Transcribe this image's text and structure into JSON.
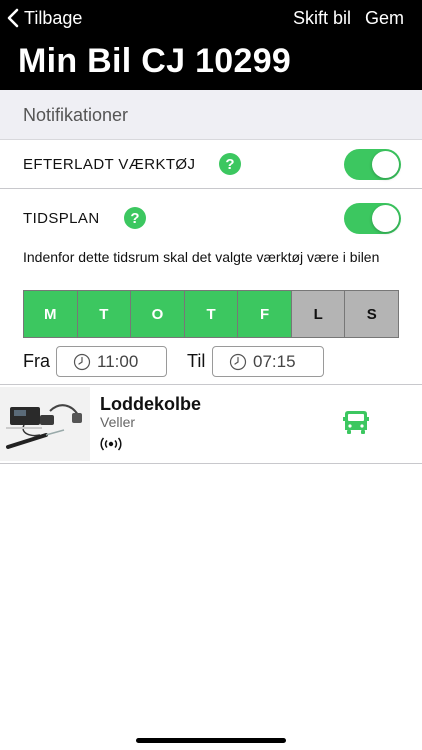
{
  "nav": {
    "back_label": "Tilbage",
    "switch_car_label": "Skift bil",
    "save_label": "Gem"
  },
  "page": {
    "title": "Min Bil CJ 10299"
  },
  "section": {
    "title": "Notifikationer"
  },
  "settings": {
    "left_tool": {
      "label": "EFTERLADT VÆRKTØJ",
      "help": "?",
      "enabled": true
    },
    "schedule": {
      "label": "TIDSPLAN",
      "help": "?",
      "enabled": true
    },
    "description": "Indenfor dette tidsrum skal det valgte værktøj være i bilen"
  },
  "days": [
    {
      "label": "M",
      "active": true
    },
    {
      "label": "T",
      "active": true
    },
    {
      "label": "O",
      "active": true
    },
    {
      "label": "T",
      "active": true
    },
    {
      "label": "F",
      "active": true
    },
    {
      "label": "L",
      "active": false
    },
    {
      "label": "S",
      "active": false
    }
  ],
  "time": {
    "from_label": "Fra",
    "from_value": "11:00",
    "to_label": "Til",
    "to_value": "07:15"
  },
  "tool": {
    "name": "Loddekolbe",
    "brand": "Veller",
    "signal_icon": "signal-broadcast-icon",
    "status_icon": "van-icon"
  },
  "colors": {
    "accent": "#3cc760",
    "header_bg": "#000000",
    "day_off": "#b4b4b4",
    "section_bg": "#efeff4"
  }
}
